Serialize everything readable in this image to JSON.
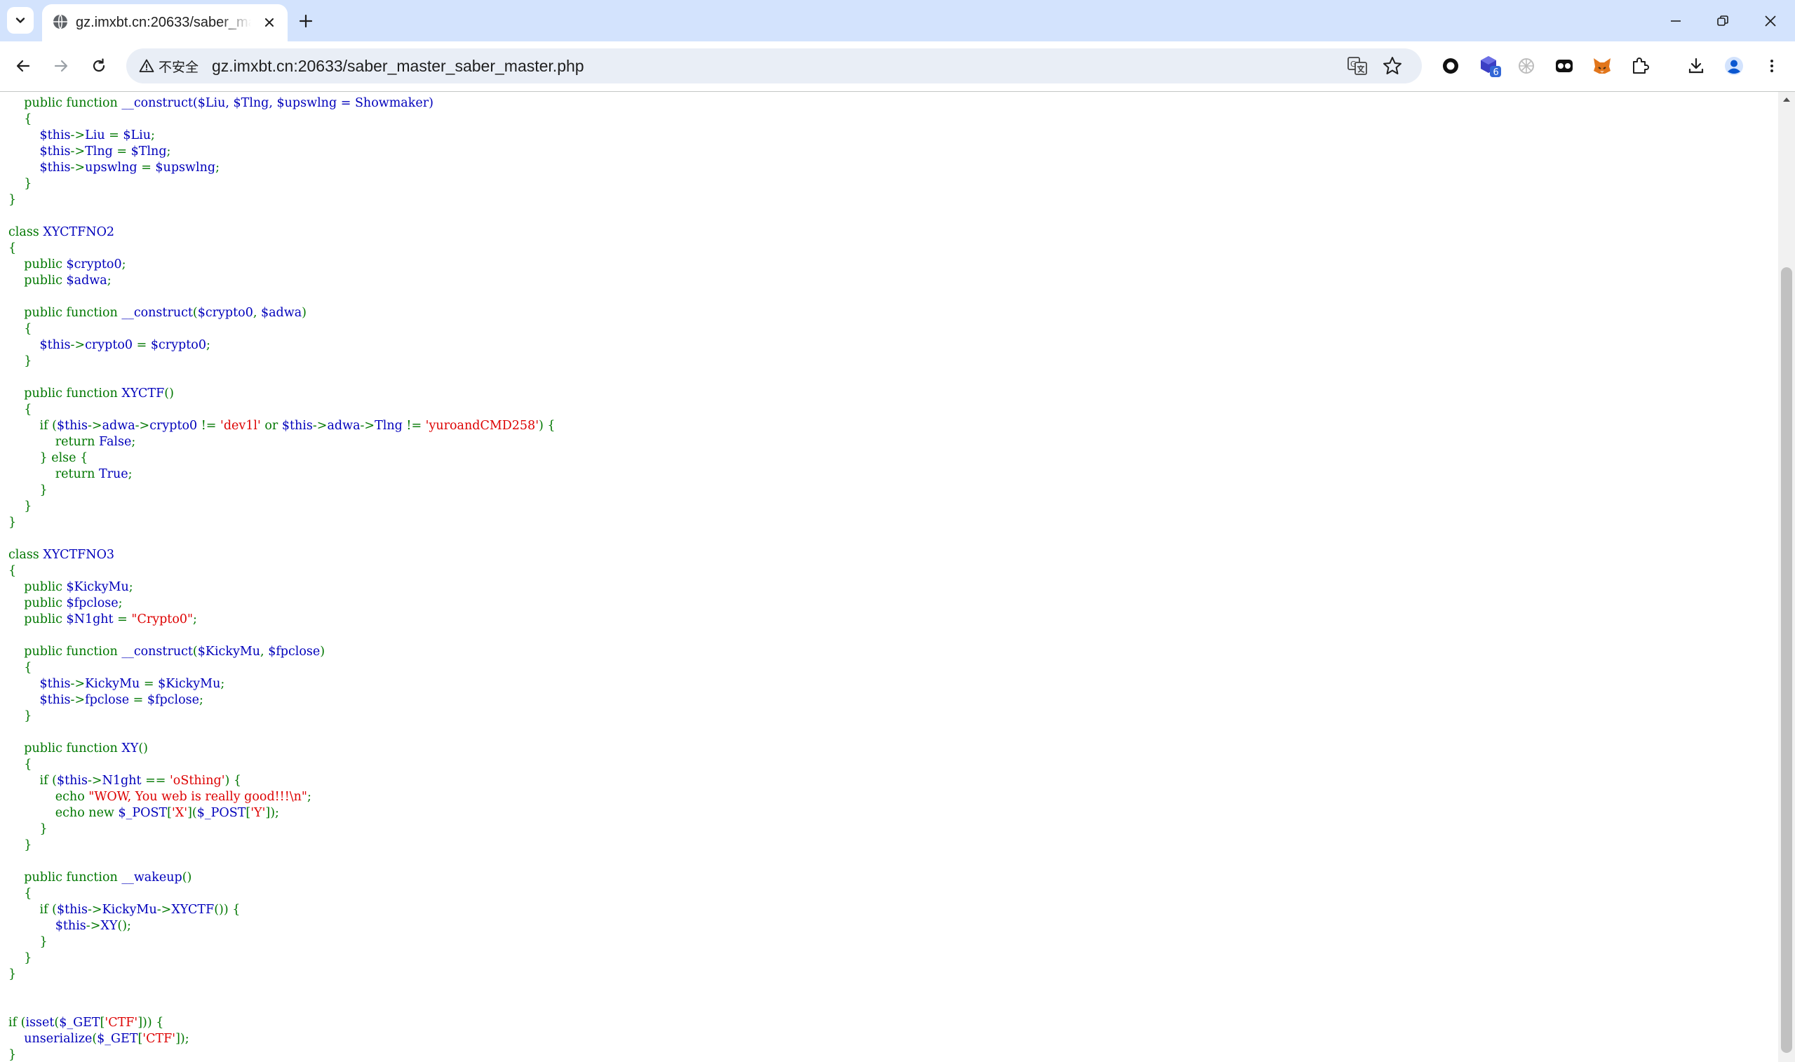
{
  "browser": {
    "tab_title": "gz.imxbt.cn:20633/saber_master_saber_master.php",
    "security_label": "不安全",
    "url": "gz.imxbt.cn:20633/saber_master_saber_master.php",
    "extension_badge": "6"
  },
  "code": {
    "l01": [
      "    ",
      "public",
      " ",
      "function",
      " __construct($Liu, $Tlng, $upswlng = Showmaker)"
    ],
    "l02": [
      "    ",
      "{"
    ],
    "l03": [
      "        $this",
      "->",
      "Liu ",
      "=",
      " $Liu",
      ";"
    ],
    "l04": [
      "        $this",
      "->",
      "Tlng ",
      "=",
      " $Tlng",
      ";"
    ],
    "l05": [
      "        $this",
      "->",
      "upswlng ",
      "=",
      " $upswlng",
      ";"
    ],
    "l06": [
      "    ",
      "}"
    ],
    "l07": [
      "}"
    ],
    "l08": [
      ""
    ],
    "l09": [
      "class ",
      "XYCTFNO2"
    ],
    "l10": [
      "{"
    ],
    "l11": [
      "    ",
      "public",
      " $crypto0",
      ";"
    ],
    "l12": [
      "    ",
      "public",
      " $adwa",
      ";"
    ],
    "l13": [
      ""
    ],
    "l14": [
      "    ",
      "public function",
      " __construct",
      "(",
      "$crypto0",
      ", ",
      "$adwa",
      ")"
    ],
    "l15": [
      "    ",
      "{"
    ],
    "l16": [
      "        $this",
      "->",
      "crypto0 ",
      "=",
      " $crypto0",
      ";"
    ],
    "l17": [
      "    ",
      "}"
    ],
    "l18": [
      ""
    ],
    "l19": [
      "    ",
      "public function",
      " XYCTF",
      "()"
    ],
    "l20": [
      "    ",
      "{"
    ],
    "l21": [
      "        ",
      "if (",
      "$this",
      "->",
      "adwa",
      "->",
      "crypto0 ",
      "!= ",
      "'dev1l'",
      " or ",
      "$this",
      "->",
      "adwa",
      "->",
      "Tlng ",
      "!= ",
      "'yuroandCMD258'",
      ") {"
    ],
    "l22": [
      "            ",
      "return ",
      "False",
      ";"
    ],
    "l23": [
      "        ",
      "} else {"
    ],
    "l24": [
      "            ",
      "return ",
      "True",
      ";"
    ],
    "l25": [
      "        ",
      "}"
    ],
    "l26": [
      "    ",
      "}"
    ],
    "l27": [
      "}"
    ],
    "l28": [
      ""
    ],
    "l29": [
      "class ",
      "XYCTFNO3"
    ],
    "l30": [
      "{"
    ],
    "l31": [
      "    ",
      "public",
      " $KickyMu",
      ";"
    ],
    "l32": [
      "    ",
      "public",
      " $fpclose",
      ";"
    ],
    "l33": [
      "    ",
      "public",
      " $N1ght ",
      "= ",
      "\"Crypto0\"",
      ";"
    ],
    "l34": [
      ""
    ],
    "l35": [
      "    ",
      "public function",
      " __construct",
      "(",
      "$KickyMu",
      ", ",
      "$fpclose",
      ")"
    ],
    "l36": [
      "    ",
      "{"
    ],
    "l37": [
      "        $this",
      "->",
      "KickyMu ",
      "=",
      " $KickyMu",
      ";"
    ],
    "l38": [
      "        $this",
      "->",
      "fpclose ",
      "=",
      " $fpclose",
      ";"
    ],
    "l39": [
      "    ",
      "}"
    ],
    "l40": [
      ""
    ],
    "l41": [
      "    ",
      "public function",
      " XY",
      "()"
    ],
    "l42": [
      "    ",
      "{"
    ],
    "l43": [
      "        ",
      "if (",
      "$this",
      "->",
      "N1ght ",
      "== ",
      "'oSthing'",
      ") {"
    ],
    "l44": [
      "            ",
      "echo ",
      "\"WOW, You web is really good!!!\\n\"",
      ";"
    ],
    "l45": [
      "            ",
      "echo new ",
      "$_POST",
      "[",
      "'X'",
      "](",
      "$_POST",
      "[",
      "'Y'",
      "]);"
    ],
    "l46": [
      "        ",
      "}"
    ],
    "l47": [
      "    ",
      "}"
    ],
    "l48": [
      ""
    ],
    "l49": [
      "    ",
      "public function",
      " __wakeup",
      "()"
    ],
    "l50": [
      "    ",
      "{"
    ],
    "l51": [
      "        ",
      "if (",
      "$this",
      "->",
      "KickyMu",
      "->",
      "XYCTF",
      "()) {"
    ],
    "l52": [
      "            ",
      "$this",
      "->",
      "XY",
      "();"
    ],
    "l53": [
      "        ",
      "}"
    ],
    "l54": [
      "    ",
      "}"
    ],
    "l55": [
      "}"
    ],
    "l56": [
      ""
    ],
    "l57": [
      ""
    ],
    "l58": [
      "if (",
      "isset",
      "(",
      "$_GET",
      "[",
      "'CTF'",
      "])) {"
    ],
    "l59": [
      "    ",
      "unserialize",
      "(",
      "$_GET",
      "[",
      "'CTF'",
      "]);"
    ],
    "l60": [
      "}"
    ]
  }
}
